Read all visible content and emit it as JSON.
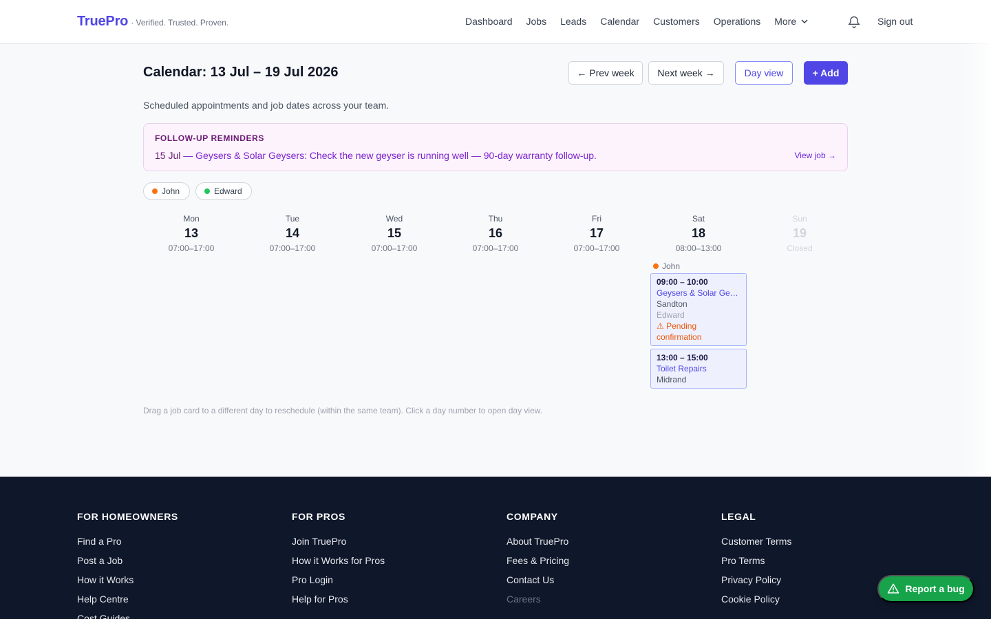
{
  "brand": {
    "name": "TruePro",
    "tagline": "· Verified. Trusted. Proven."
  },
  "nav": {
    "items": [
      "Dashboard",
      "Jobs",
      "Leads",
      "Calendar",
      "Customers",
      "Operations"
    ],
    "more_label": "More",
    "signout_label": "Sign out"
  },
  "page": {
    "title": "Calendar: 13 Jul – 19 Jul 2026",
    "subtitle": "Scheduled appointments and job dates across your team.",
    "hint": "Drag a job card to a different day to reschedule (within the same team). Click a day number to open day view."
  },
  "toolbar": {
    "prev_label": "← Prev week",
    "next_label": "Next week →",
    "day_view_label": "Day view",
    "add_label": "+ Add"
  },
  "reminders": {
    "heading": "FOLLOW-UP REMINDERS",
    "date": "15 Jul",
    "text": " — Geysers & Solar Geysers: Check the new geyser is running well — 90-day warranty follow-up.",
    "link_label": "View job →"
  },
  "team": [
    {
      "name": "John",
      "color": "#f97316"
    },
    {
      "name": "Edward",
      "color": "#22c55e"
    }
  ],
  "days": [
    {
      "dow": "Mon",
      "num": "13",
      "hours": "07:00–17:00"
    },
    {
      "dow": "Tue",
      "num": "14",
      "hours": "07:00–17:00"
    },
    {
      "dow": "Wed",
      "num": "15",
      "hours": "07:00–17:00"
    },
    {
      "dow": "Thu",
      "num": "16",
      "hours": "07:00–17:00"
    },
    {
      "dow": "Fri",
      "num": "17",
      "hours": "07:00–17:00"
    },
    {
      "dow": "Sat",
      "num": "18",
      "hours": "08:00–13:00"
    },
    {
      "dow": "Sun",
      "num": "19",
      "hours": "Closed"
    }
  ],
  "saturday": {
    "assignee": "John",
    "jobs": [
      {
        "time": "09:00 – 10:00",
        "service": "Geysers & Solar Geysers",
        "area": "Sandton",
        "person": "Edward",
        "status": "⚠ Pending confirmation"
      },
      {
        "time": "13:00 – 15:00",
        "service": "Toilet Repairs",
        "area": "Midrand"
      }
    ]
  },
  "footer": {
    "columns": [
      {
        "heading": "FOR HOMEOWNERS",
        "links": [
          "Find a Pro",
          "Post a Job",
          "How it Works",
          "Help Centre",
          "Cost Guides"
        ]
      },
      {
        "heading": "FOR PROS",
        "links": [
          "Join TruePro",
          "How it Works for Pros",
          "Pro Login",
          "Help for Pros"
        ]
      },
      {
        "heading": "COMPANY",
        "links": [
          "About TruePro",
          "Fees & Pricing",
          "Contact Us",
          "Careers"
        ]
      },
      {
        "heading": "LEGAL",
        "links": [
          "Customer Terms",
          "Pro Terms",
          "Privacy Policy",
          "Cookie Policy"
        ]
      }
    ]
  },
  "bug_button": {
    "label": "Report a bug",
    "color": "#16a34a"
  },
  "colors": {
    "accent": "#4f46e5",
    "footer_bg": "#0f172a"
  }
}
